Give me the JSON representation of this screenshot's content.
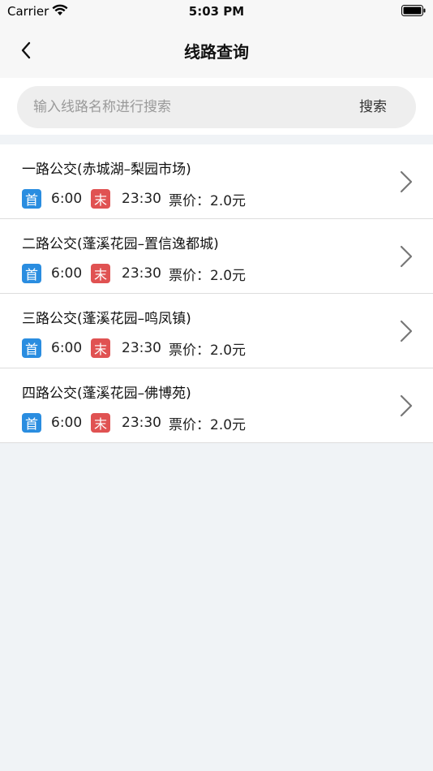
{
  "status_bar": {
    "carrier": "Carrier",
    "time": "5:03 PM"
  },
  "nav": {
    "title": "线路查询",
    "back_icon": "chevron-left-icon"
  },
  "search": {
    "placeholder": "输入线路名称进行搜索",
    "value": "",
    "button_label": "搜索"
  },
  "badges": {
    "first": "首",
    "last": "末",
    "first_color": "#2a8de0",
    "last_color": "#e05252"
  },
  "routes": [
    {
      "name": "一路公交(赤城湖–梨园市场)",
      "first_time": "6:00",
      "last_time": "23:30",
      "fare": "票价：2.0元"
    },
    {
      "name": "二路公交(蓬溪花园–置信逸都城)",
      "first_time": "6:00",
      "last_time": "23:30",
      "fare": "票价：2.0元"
    },
    {
      "name": "三路公交(蓬溪花园–鸣凤镇)",
      "first_time": "6:00",
      "last_time": "23:30",
      "fare": "票价：2.0元"
    },
    {
      "name": "四路公交(蓬溪花园–佛博苑)",
      "first_time": "6:00",
      "last_time": "23:30",
      "fare": "票价：2.0元"
    }
  ]
}
